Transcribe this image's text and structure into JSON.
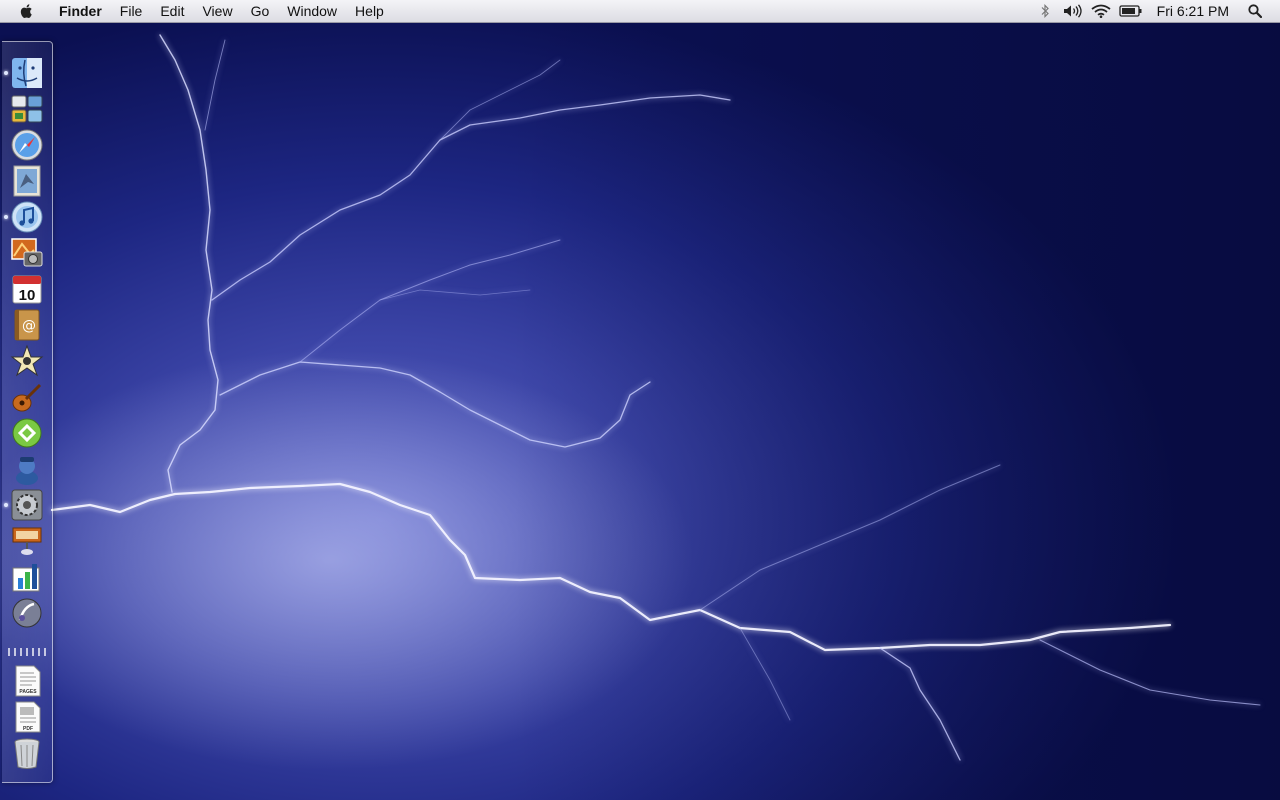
{
  "menubar": {
    "apple_icon": "apple-logo-icon",
    "app_name": "Finder",
    "menus": [
      "File",
      "Edit",
      "View",
      "Go",
      "Window",
      "Help"
    ],
    "status_icons": [
      "bluetooth-icon",
      "volume-icon",
      "wifi-icon",
      "battery-icon"
    ],
    "clock": "Fri 6:21 PM",
    "spotlight_icon": "spotlight-search-icon"
  },
  "dock": {
    "items": [
      {
        "name": "Finder",
        "icon": "finder-icon",
        "running": true
      },
      {
        "name": "Dashboard",
        "icon": "dashboard-icon",
        "running": false
      },
      {
        "name": "Safari",
        "icon": "safari-icon",
        "running": false
      },
      {
        "name": "Mail",
        "icon": "mail-icon",
        "running": false
      },
      {
        "name": "iTunes",
        "icon": "itunes-icon",
        "running": true
      },
      {
        "name": "iPhoto",
        "icon": "iphoto-icon",
        "running": false
      },
      {
        "name": "iCal",
        "icon": "ical-icon",
        "running": false,
        "label": "10"
      },
      {
        "name": "Address Book",
        "icon": "address-book-icon",
        "running": false
      },
      {
        "name": "iMovie",
        "icon": "imovie-icon",
        "running": false
      },
      {
        "name": "GarageBand",
        "icon": "garageband-icon",
        "running": false
      },
      {
        "name": "Green App",
        "icon": "green-app-icon",
        "running": false
      },
      {
        "name": "Character App",
        "icon": "character-app-icon",
        "running": false
      },
      {
        "name": "System Preferences",
        "icon": "system-preferences-icon",
        "running": true
      },
      {
        "name": "Keynote",
        "icon": "keynote-icon",
        "running": false
      },
      {
        "name": "Numbers",
        "icon": "numbers-icon",
        "running": false
      },
      {
        "name": "Script App",
        "icon": "script-app-icon",
        "running": false
      },
      {
        "name": "Pages Document",
        "icon": "pages-document-icon",
        "running": false,
        "label": "PAGES"
      },
      {
        "name": "PDF Document",
        "icon": "pdf-document-icon",
        "running": false,
        "label": "PDF"
      },
      {
        "name": "Trash",
        "icon": "trash-icon",
        "running": false
      }
    ]
  },
  "desktop": {
    "wallpaper": "lightning-storm"
  }
}
